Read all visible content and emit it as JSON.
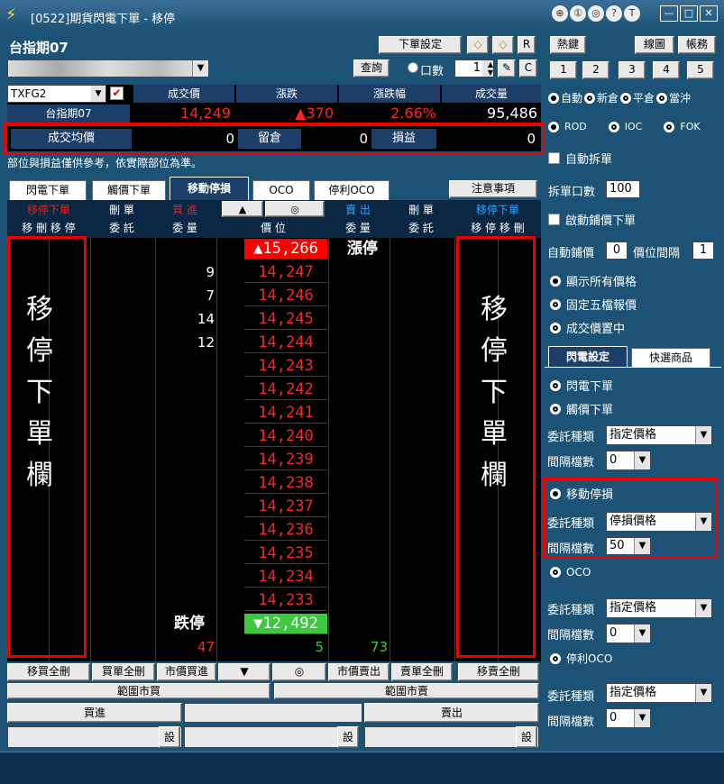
{
  "window": {
    "title": "[0522]期貨閃電下單 - 移停",
    "controls": [
      "⊕",
      "①",
      "◎",
      "?",
      "T",
      "—",
      "□",
      "✕"
    ]
  },
  "header": {
    "product": "台指期07",
    "order_settings": "下單設定",
    "r_btn": "R",
    "c_btn": "C",
    "query": "查詢",
    "lots_label": "口數",
    "lots_value": "1"
  },
  "right_top": {
    "hotkey": "熱鍵",
    "chart": "線圖",
    "account": "帳務",
    "nums": [
      "1",
      "2",
      "3",
      "4",
      "5"
    ]
  },
  "quote": {
    "symbol": "TXFG2",
    "name": "台指期07",
    "headers": [
      "成交價",
      "漲跌",
      "漲跌幅",
      "成交量"
    ],
    "last": "14,249",
    "change": "▲370",
    "change_pct": "2.66%",
    "volume": "95,486"
  },
  "position": {
    "avg_label": "成交均價",
    "avg_value": "0",
    "hold_label": "留倉",
    "hold_value": "0",
    "pnl_label": "損益",
    "pnl_value": "0"
  },
  "notice": "部位與損益僅供參考，依實際部位為準。",
  "tabs": [
    "閃電下單",
    "觸價下單",
    "移動停損",
    "OCO",
    "停利OCO"
  ],
  "attention": "注意事項",
  "ladder_head": {
    "left_top": "移停下單",
    "left_sub": "移 刪 移 停",
    "del_top": "刪 單",
    "del_sub": "委 託",
    "buy_top": "買 進",
    "buy_sub": "委 量",
    "up": "▲",
    "center": "◎",
    "price_sub": "價 位",
    "sell_top": "賣 出",
    "sell_sub": "委 量",
    "del2_top": "刪 單",
    "del2_sub": "委 託",
    "right_top": "移停下單",
    "right_sub": "移 停 移 刪"
  },
  "ladder": {
    "limit_up_label": "漲停",
    "limit_up": "▲15,266",
    "rows": [
      {
        "price": "14,247",
        "bid": "9"
      },
      {
        "price": "14,246",
        "bid": "7"
      },
      {
        "price": "14,245",
        "bid": "14"
      },
      {
        "price": "14,244",
        "bid": "12"
      },
      {
        "price": "14,243",
        "bid": ""
      },
      {
        "price": "14,242",
        "bid": ""
      },
      {
        "price": "14,241",
        "bid": ""
      },
      {
        "price": "14,240",
        "bid": ""
      },
      {
        "price": "14,239",
        "bid": ""
      },
      {
        "price": "14,238",
        "bid": ""
      },
      {
        "price": "14,237",
        "bid": ""
      },
      {
        "price": "14,236",
        "bid": ""
      },
      {
        "price": "14,235",
        "bid": ""
      },
      {
        "price": "14,234",
        "bid": ""
      },
      {
        "price": "14,233",
        "bid": ""
      }
    ],
    "limit_down_label": "跌停",
    "limit_down": "▼12,492",
    "total_bid": "47",
    "total_mid": "5",
    "total_ask": "73"
  },
  "side_label_chars": [
    "移",
    "停",
    "下",
    "單",
    "欄"
  ],
  "bottom_buttons": [
    "移買全刪",
    "買單全刪",
    "市價買進",
    "▼",
    "◎",
    "市價賣出",
    "賣單全刪",
    "移賣全刪"
  ],
  "range_buy": "範圍市買",
  "range_sell": "範圍市賣",
  "buy": "買進",
  "sell": "賣出",
  "set": "設",
  "panel": {
    "modes": [
      "自動",
      "新倉",
      "平倉",
      "當沖"
    ],
    "tif": [
      "ROD",
      "IOC",
      "FOK"
    ],
    "auto_split": "自動拆單",
    "split_qty_label": "拆單口數",
    "split_qty": "100",
    "enable_spread": "啟動鋪價下單",
    "auto_spread": "自動鋪價",
    "auto_spread_val": "0",
    "price_gap": "價位間隔",
    "price_gap_val": "1",
    "display": [
      "顯示所有價格",
      "固定五檔報價",
      "成交價置中"
    ],
    "subtabs": [
      "閃電設定",
      "快選商品"
    ],
    "flash_opts": [
      "閃電下單",
      "觸價下單"
    ],
    "order_type": "委託種類",
    "interval": "間隔檔數",
    "flash_type": "指定價格",
    "flash_interval": "0",
    "trailing": "移動停損",
    "trailing_type": "停損價格",
    "trailing_interval": "50",
    "oco": "OCO",
    "oco_type": "指定價格",
    "oco_interval": "0",
    "tp_oco": "停利OCO",
    "tp_type": "指定價格",
    "tp_interval": "0"
  }
}
